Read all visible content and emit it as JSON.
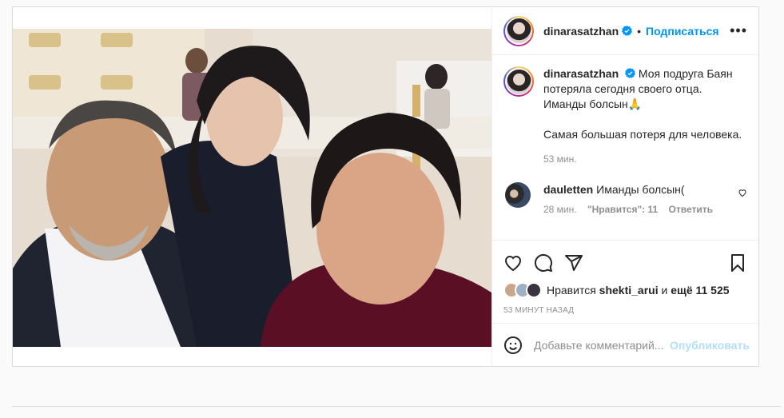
{
  "post": {
    "username": "dinarasatzhan",
    "follow_label": "Подписаться",
    "separator": "•",
    "more_label": "•••",
    "caption": {
      "username": "dinarasatzhan",
      "text_line1": "Моя подруга Баян потеряла сегодня своего отца. Иманды болсын🙏",
      "text_line2": "Самая большая потеря для человека.",
      "time": "53 мин."
    },
    "comments": [
      {
        "username": "dauletten",
        "text": "Иманды болсын(",
        "time": "28 мин.",
        "likes": "\"Нравится\": 11",
        "reply_label": "Ответить"
      }
    ],
    "likes": {
      "prefix": "Нравится",
      "user": "shekti_arui",
      "middle": "и",
      "rest": "ещё 11 525"
    },
    "ago": "53 МИНУТ НАЗАД",
    "add_comment": {
      "placeholder": "Добавьте комментарий...",
      "publish_label": "Опубликовать"
    }
  },
  "colors": {
    "accent": "#0095f6",
    "publish_disabled": "#b2dffc",
    "muted": "#8e8e8e",
    "border": "#dbdbdb"
  },
  "icons": [
    "verified-badge-icon",
    "heart-icon",
    "comment-icon",
    "share-icon",
    "bookmark-icon",
    "emoji-icon",
    "more-icon"
  ]
}
